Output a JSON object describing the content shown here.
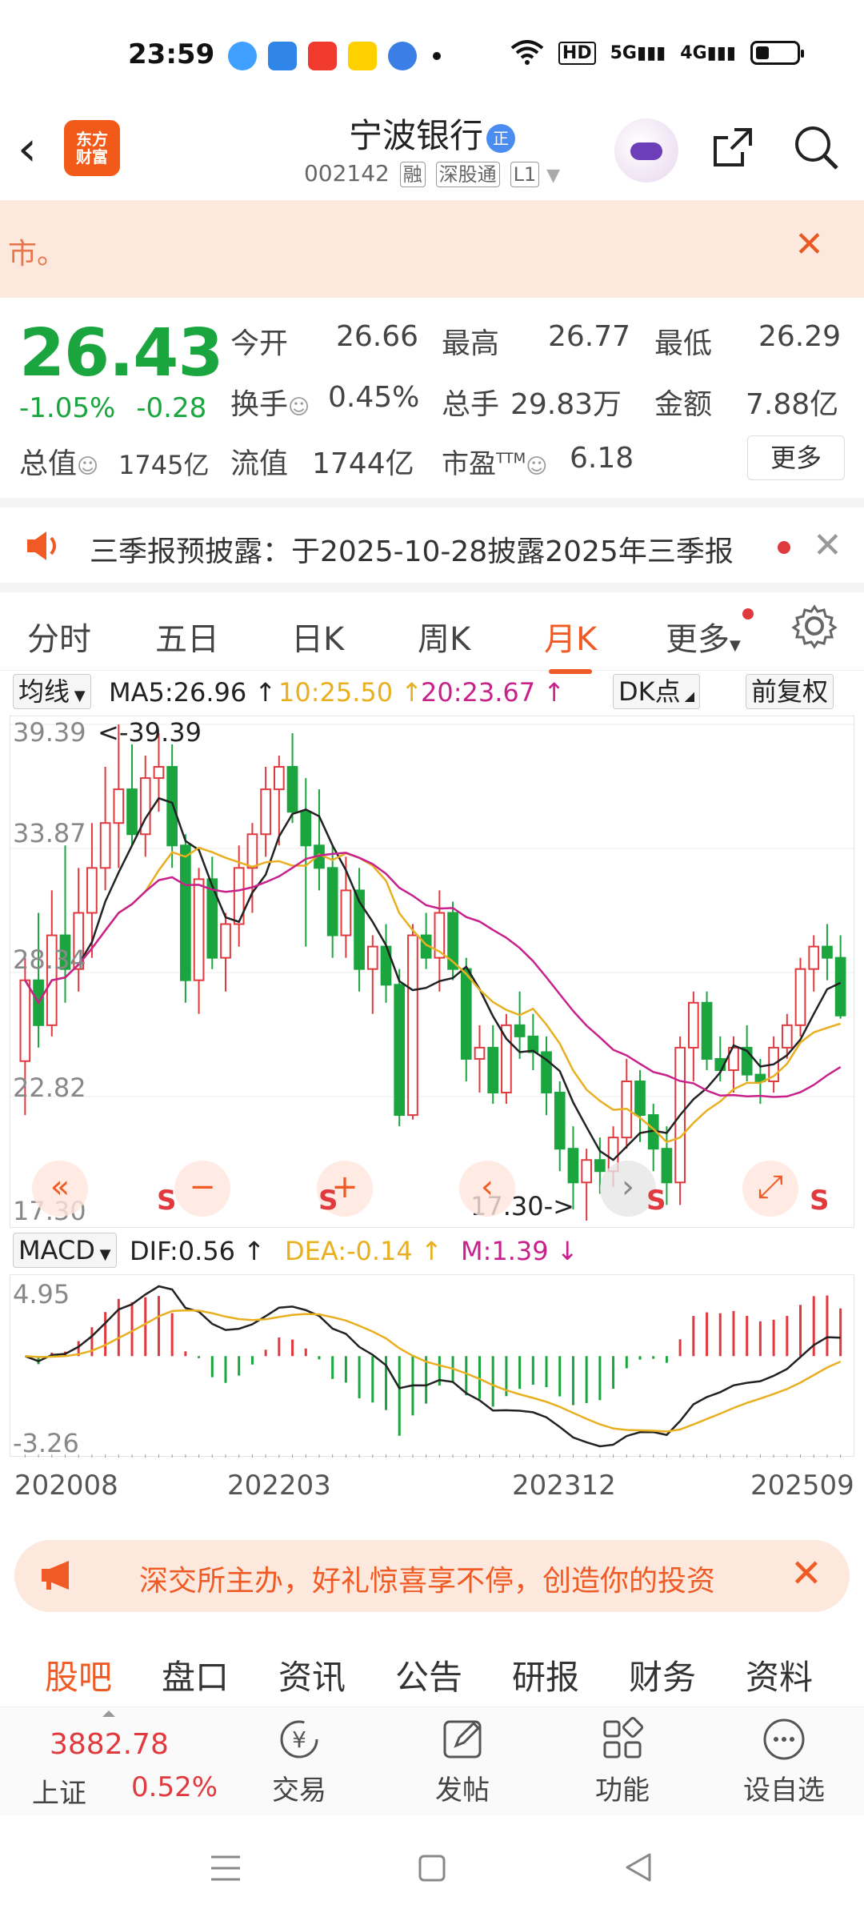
{
  "status": {
    "time": "23:59",
    "network": [
      "HD",
      "5G",
      "4G"
    ],
    "icons": [
      "qq-browser-icon",
      "browser-icon",
      "video-icon",
      "meituan-icon",
      "app-icon"
    ]
  },
  "header": {
    "logo_line1": "东方",
    "logo_line2": "财富",
    "stock_name": "宁波银行",
    "badge": "正",
    "code": "002142",
    "tags": [
      "融",
      "深股通",
      "L1"
    ]
  },
  "notice": {
    "text": "市。"
  },
  "quote": {
    "price": "26.43",
    "change_pct": "-1.05%",
    "change": "-0.28",
    "open_label": "今开",
    "open": "26.66",
    "high_label": "最高",
    "high": "26.77",
    "low_label": "最低",
    "low": "26.29",
    "turnover_label": "换手",
    "turnover": "0.45%",
    "volume_label": "总手",
    "volume": "29.83万",
    "amount_label": "金额",
    "amount": "7.88亿",
    "mktcap_label": "总值",
    "mktcap": "1745亿",
    "float_label": "流值",
    "float": "1744亿",
    "pe_label": "市盈",
    "pe_sup": "TTM",
    "pe": "6.18",
    "more": "更多"
  },
  "announcement": {
    "text": "三季报预披露：于2025-10-28披露2025年三季报"
  },
  "period_tabs": [
    "分时",
    "五日",
    "日K",
    "周K",
    "月K",
    "更多"
  ],
  "active_period": "月K",
  "indicator_bar": {
    "selector": "均线",
    "ma5": "MA5:26.96",
    "ma10": "10:25.50",
    "ma20": "20:23.67",
    "dk": "DK点",
    "adjust": "前复权"
  },
  "macd_bar": {
    "selector": "MACD",
    "dif": "DIF:0.56",
    "dea": "DEA:-0.14",
    "m": "M:1.39"
  },
  "colors": {
    "up": "#e0393e",
    "down": "#1aa53f",
    "accent": "#f05a24",
    "ma5": "#222222",
    "ma10": "#e8b020",
    "ma20": "#c8218c"
  },
  "chart_data": {
    "type": "candlestick",
    "price_axis_labels": [
      "39.39",
      "33.87",
      "28.34",
      "22.82",
      "17.30"
    ],
    "max_label": "<-39.39",
    "min_label": "17.30->",
    "ylim": [
      17.3,
      39.39
    ],
    "macd_axis_labels": [
      "4.95",
      "-3.26"
    ],
    "x_labels": [
      "202008",
      "202203",
      "202312",
      "202509"
    ],
    "sell_marks": [
      "S",
      "S",
      "S",
      "S"
    ],
    "candles": [
      [
        24.4,
        29.0,
        22.0,
        28.0
      ],
      [
        28.0,
        31.0,
        25.0,
        26.0
      ],
      [
        26.0,
        32.0,
        25.5,
        30.0
      ],
      [
        30.0,
        34.0,
        27.0,
        28.5
      ],
      [
        28.5,
        33.0,
        27.5,
        31.0
      ],
      [
        31.0,
        35.0,
        29.0,
        33.0
      ],
      [
        33.0,
        37.5,
        32.0,
        35.0
      ],
      [
        35.0,
        39.39,
        33.0,
        36.5
      ],
      [
        36.5,
        38.5,
        34.0,
        34.5
      ],
      [
        34.5,
        38.0,
        33.5,
        37.0
      ],
      [
        37.0,
        39.0,
        35.5,
        37.5
      ],
      [
        37.5,
        38.5,
        33.0,
        34.0
      ],
      [
        34.0,
        34.5,
        27.0,
        28.0
      ],
      [
        28.0,
        33.0,
        26.5,
        32.5
      ],
      [
        32.5,
        33.5,
        28.5,
        29.0
      ],
      [
        29.0,
        31.0,
        27.5,
        30.5
      ],
      [
        30.5,
        34.0,
        29.5,
        33.0
      ],
      [
        33.0,
        35.0,
        31.0,
        34.5
      ],
      [
        34.5,
        37.5,
        33.5,
        36.5
      ],
      [
        36.5,
        38.0,
        34.0,
        37.5
      ],
      [
        37.5,
        39.0,
        35.0,
        35.5
      ],
      [
        35.5,
        37.0,
        29.5,
        34.0
      ],
      [
        34.0,
        36.5,
        32.0,
        33.0
      ],
      [
        33.0,
        34.0,
        29.0,
        30.0
      ],
      [
        30.0,
        33.5,
        29.0,
        32.0
      ],
      [
        32.0,
        33.0,
        27.5,
        28.5
      ],
      [
        28.5,
        30.0,
        26.5,
        29.5
      ],
      [
        29.5,
        30.5,
        27.0,
        27.8
      ],
      [
        27.8,
        28.5,
        21.5,
        22.0
      ],
      [
        22.0,
        30.5,
        21.8,
        30.0
      ],
      [
        30.0,
        31.0,
        28.5,
        29.0
      ],
      [
        29.0,
        32.0,
        27.5,
        31.0
      ],
      [
        31.0,
        31.5,
        28.0,
        28.5
      ],
      [
        28.5,
        29.0,
        23.5,
        24.5
      ],
      [
        24.5,
        26.0,
        23.0,
        25.0
      ],
      [
        25.0,
        26.0,
        22.5,
        23.0
      ],
      [
        23.0,
        26.5,
        22.5,
        26.0
      ],
      [
        26.0,
        27.5,
        24.5,
        25.5
      ],
      [
        25.5,
        26.5,
        24.0,
        24.8
      ],
      [
        24.8,
        25.5,
        22.0,
        23.0
      ],
      [
        23.0,
        23.5,
        19.5,
        20.5
      ],
      [
        20.5,
        21.5,
        17.8,
        19.0
      ],
      [
        19.0,
        20.5,
        17.3,
        20.0
      ],
      [
        20.0,
        21.0,
        18.5,
        19.5
      ],
      [
        19.5,
        21.5,
        18.8,
        21.0
      ],
      [
        21.0,
        24.5,
        20.5,
        23.5
      ],
      [
        23.5,
        24.0,
        20.8,
        22.0
      ],
      [
        22.0,
        22.5,
        19.5,
        20.5
      ],
      [
        20.5,
        21.5,
        18.0,
        19.0
      ],
      [
        19.0,
        25.5,
        18.0,
        25.0
      ],
      [
        25.0,
        27.5,
        23.5,
        27.0
      ],
      [
        27.0,
        27.5,
        24.0,
        24.5
      ],
      [
        24.5,
        25.5,
        23.5,
        24.0
      ],
      [
        24.0,
        25.5,
        23.0,
        25.0
      ],
      [
        25.0,
        26.0,
        23.5,
        23.8
      ],
      [
        23.8,
        24.5,
        22.5,
        23.5
      ],
      [
        23.5,
        25.5,
        23.0,
        25.0
      ],
      [
        25.0,
        26.5,
        24.5,
        26.0
      ],
      [
        26.0,
        29.0,
        25.5,
        28.5
      ],
      [
        28.5,
        30.0,
        27.5,
        29.5
      ],
      [
        29.5,
        30.5,
        28.0,
        29.0
      ],
      [
        29.0,
        30.0,
        26.29,
        26.43
      ]
    ]
  },
  "ad_banner": {
    "text": "深交所主办，好礼惊喜享不停，创造你的投资"
  },
  "bottom_tabs": [
    "股吧",
    "盘口",
    "资讯",
    "公告",
    "研报",
    "财务",
    "资料"
  ],
  "active_bottom_tab": "股吧",
  "index": {
    "value": "3882.78",
    "name": "上证",
    "pct": "0.52%"
  },
  "toolbar": [
    "交易",
    "发帖",
    "功能",
    "设自选"
  ]
}
